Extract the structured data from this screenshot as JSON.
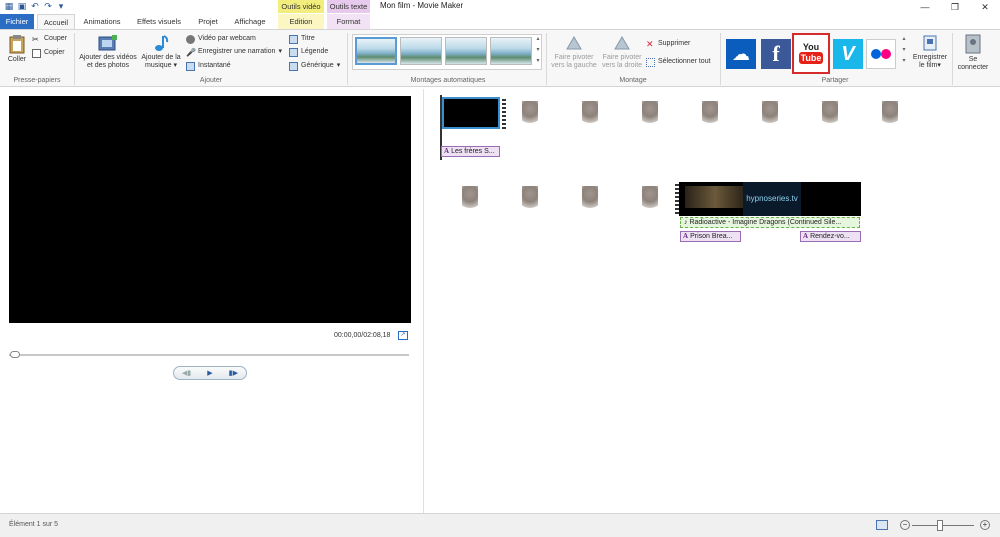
{
  "window": {
    "title": "Mon film - Movie Maker",
    "context_video": "Outils vidéo",
    "context_text": "Outils texte"
  },
  "tabs": {
    "file": "Fichier",
    "home": "Accueil",
    "animations": "Animations",
    "effects": "Effets visuels",
    "project": "Projet",
    "view": "Affichage",
    "edit": "Edition",
    "format": "Format"
  },
  "ribbon": {
    "clipboard": {
      "paste": "Coller",
      "cut": "Couper",
      "copy": "Copier",
      "label": "Presse-papiers"
    },
    "add": {
      "add_videos_line1": "Ajouter des vidéos",
      "add_videos_line2": "et des photos",
      "add_music_line1": "Ajouter de la",
      "add_music_line2": "musique",
      "webcam": "Vidéo par webcam",
      "narration": "Enregistrer une narration",
      "snapshot": "Instantané",
      "title": "Titre",
      "caption": "Légende",
      "credits": "Générique",
      "label": "Ajouter"
    },
    "automovie": {
      "label": "Montages automatiques"
    },
    "editing": {
      "rotate_left_line1": "Faire pivoter",
      "rotate_left_line2": "vers la gauche",
      "rotate_right_line1": "Faire pivoter",
      "rotate_right_line2": "vers la droite",
      "remove": "Supprimer",
      "select_all": "Sélectionner tout",
      "label": "Montage"
    },
    "share": {
      "label": "Partager",
      "save_movie_line1": "Enregistrer",
      "save_movie_line2": "le film",
      "youtube_line1": "You",
      "youtube_line2": "Tube",
      "facebook_glyph": "f",
      "vimeo_glyph": "V",
      "onedrive_glyph": "☁"
    },
    "signin": {
      "line1": "Se",
      "line2": "connecter"
    }
  },
  "preview": {
    "time": "00:00,00/02:08,18"
  },
  "storyboard": {
    "caption1": "Les frères S...",
    "music": "Radioactive - Imagine Dragons (Continued Sile...",
    "caption2": "Prison Brea...",
    "caption3": "Rendez-vo...",
    "clip_brand": "hypnoseries.tv"
  },
  "statusbar": {
    "text": "Élément 1 sur 5"
  },
  "colors": {
    "file_tab": "#2b6cc4",
    "youtube_red": "#e62117",
    "facebook_blue": "#3b5998",
    "vimeo_blue": "#1ab7ea",
    "onedrive_blue": "#0a5dbd",
    "caption_purple": "#9a6cb4",
    "music_green": "#6ab04c",
    "highlight_red": "#d62b2b"
  }
}
